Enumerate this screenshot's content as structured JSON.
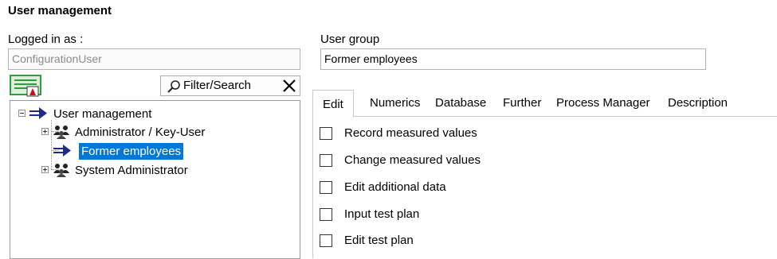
{
  "page": {
    "title": "User management"
  },
  "logged_in": {
    "label": "Logged in as :",
    "value": "ConfigurationUser"
  },
  "user_group": {
    "label": "User group",
    "value": "Former employees"
  },
  "toolbar": {
    "icon": "user-management-tool-icon",
    "filter_label": "Filter/Search"
  },
  "tree": {
    "root": {
      "label": "User management",
      "icon": "arrow-group-icon"
    },
    "children": [
      {
        "label": "Administrator / Key-User",
        "icon": "users-group-icon",
        "expanded": false,
        "selected": false
      },
      {
        "label": "Former employees",
        "icon": "arrow-group-icon",
        "expanded": null,
        "selected": true
      },
      {
        "label": "System Administrator",
        "icon": "users-group-icon",
        "expanded": false,
        "selected": false
      }
    ]
  },
  "tabs": [
    {
      "label": "Edit",
      "active": true
    },
    {
      "label": "Numerics",
      "active": false
    },
    {
      "label": "Database",
      "active": false
    },
    {
      "label": "Further",
      "active": false
    },
    {
      "label": "Process Manager",
      "active": false
    },
    {
      "label": "Description",
      "active": false
    }
  ],
  "permissions": [
    {
      "label": "Record measured values",
      "checked": false
    },
    {
      "label": "Change measured values",
      "checked": false
    },
    {
      "label": "Edit additional data",
      "checked": false
    },
    {
      "label": "Input test plan",
      "checked": false
    },
    {
      "label": "Edit test plan",
      "checked": false
    }
  ],
  "colors": {
    "selection": "#0078d7",
    "icon_navy": "#1f2a8a",
    "icon_green": "#2e9e3a",
    "icon_red": "#cc1010"
  }
}
